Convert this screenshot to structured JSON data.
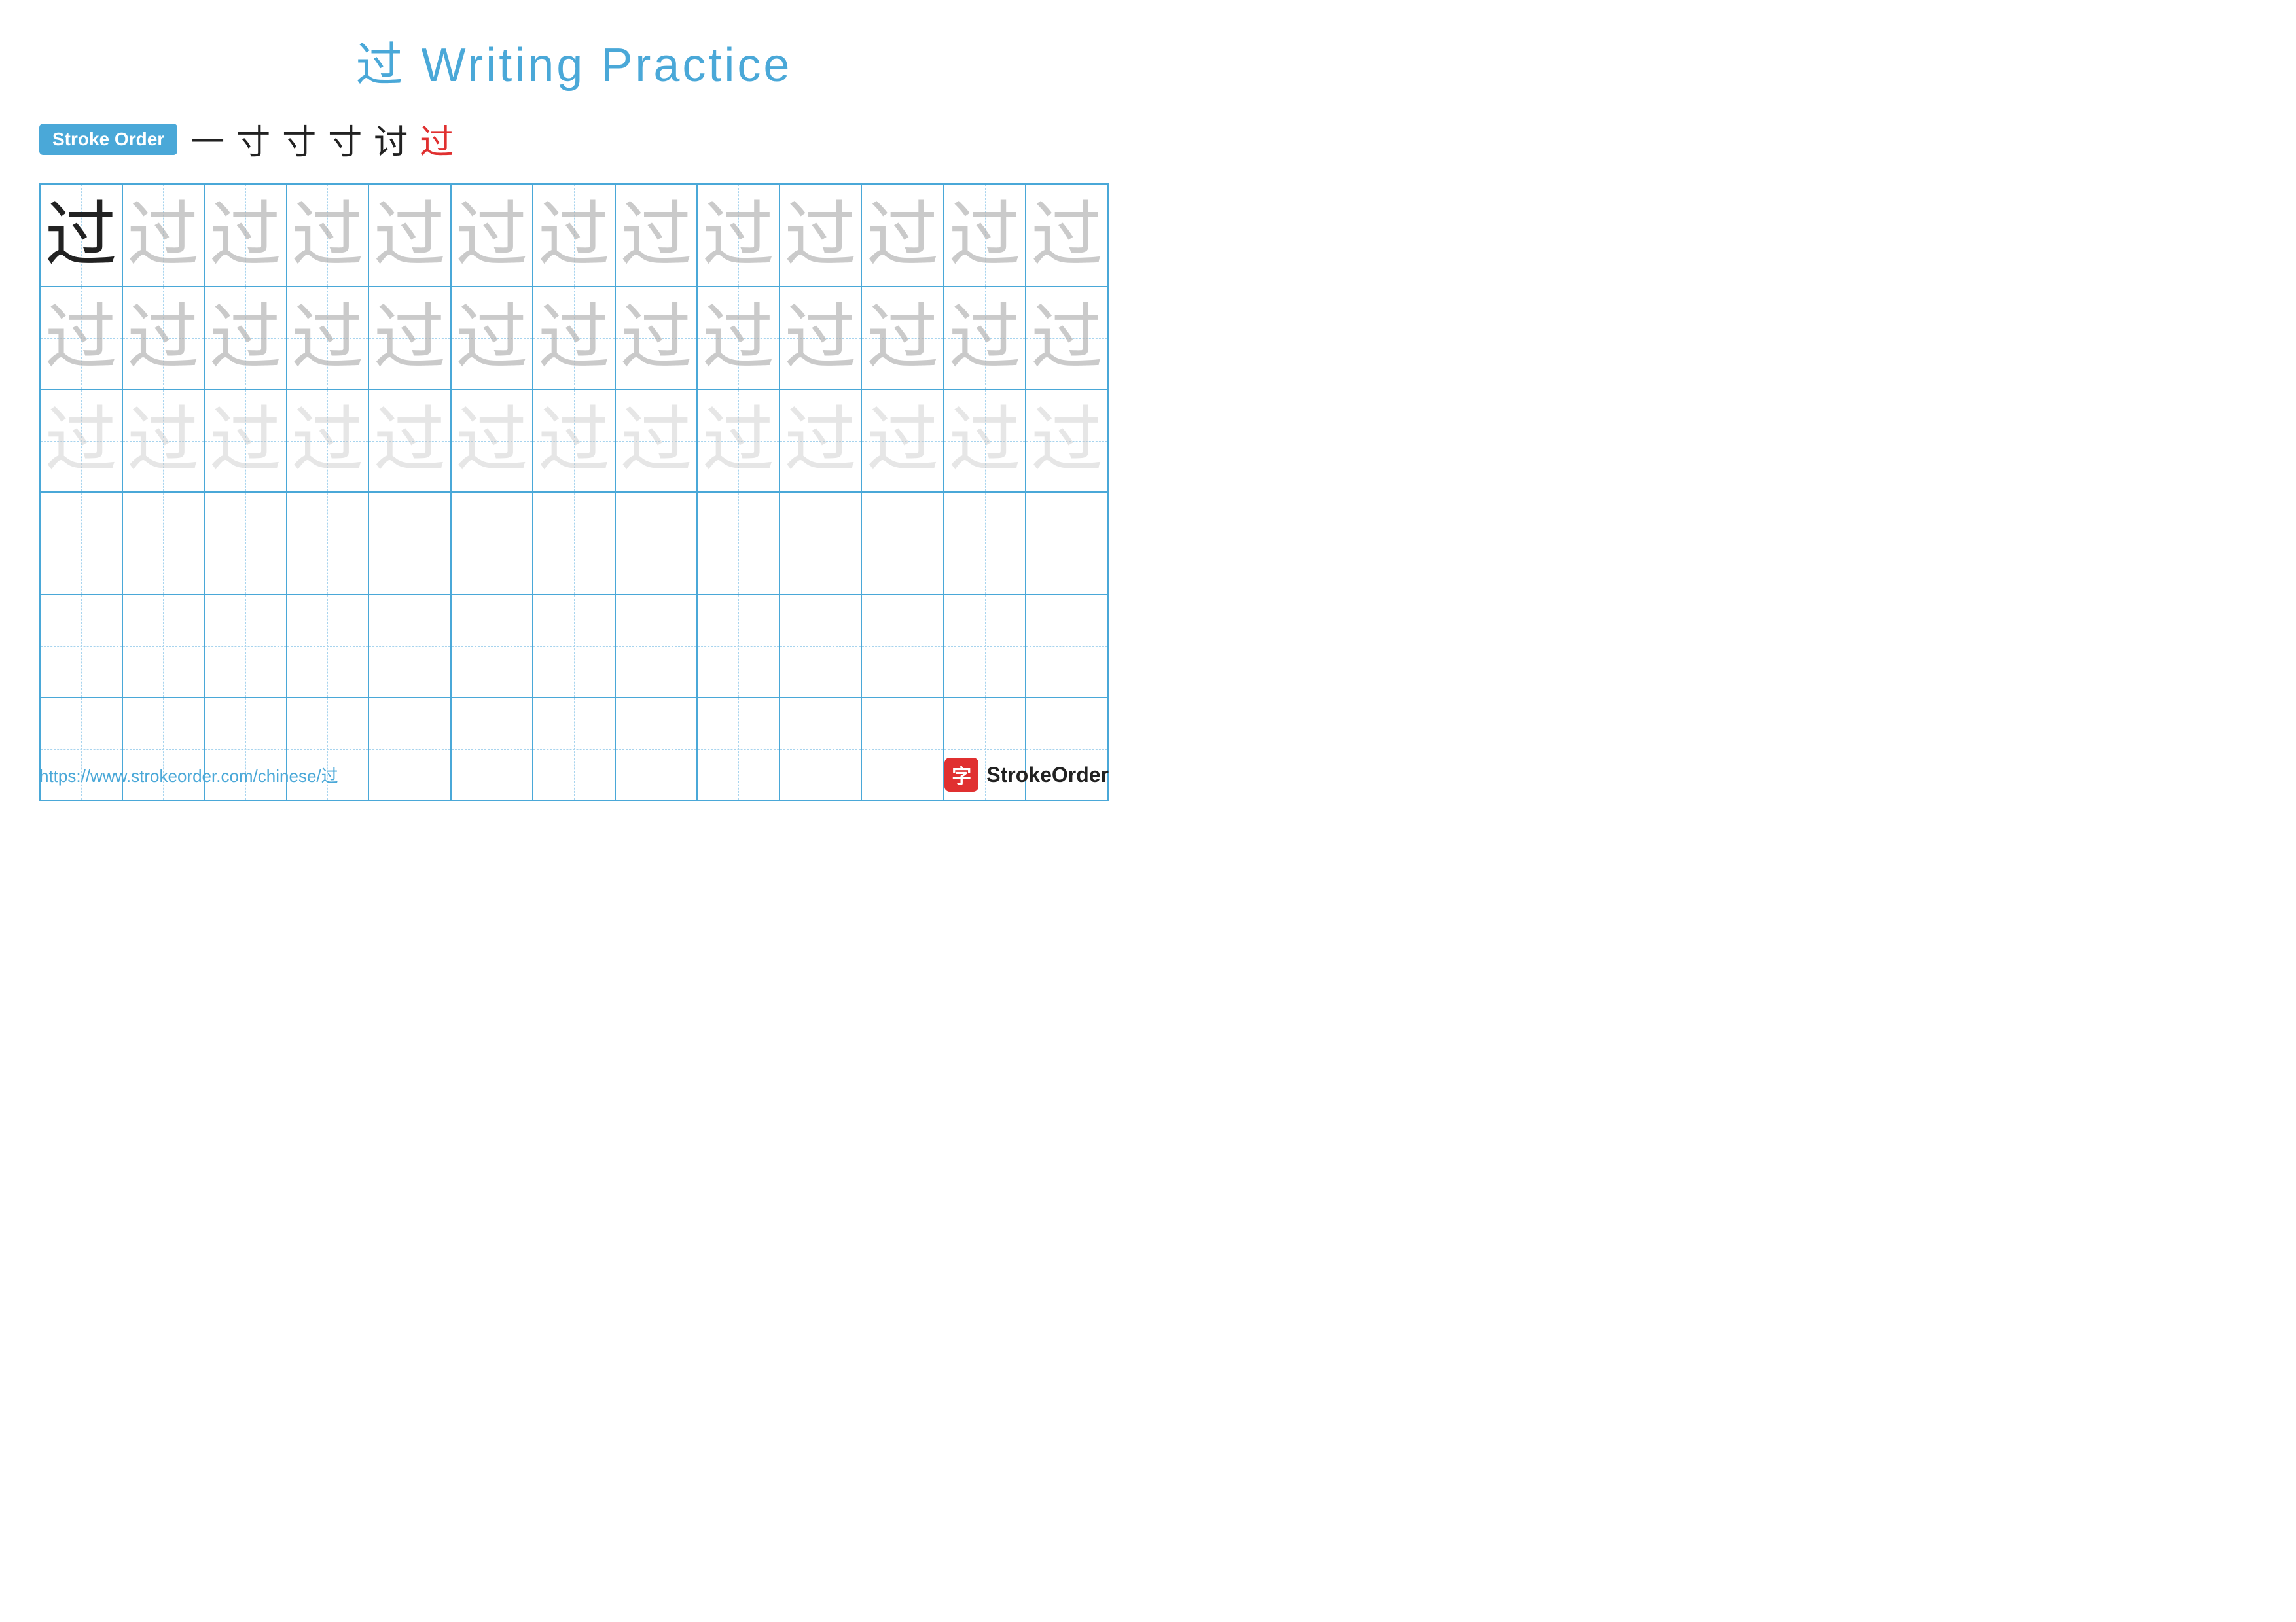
{
  "title": {
    "char": "过",
    "text": " Writing Practice"
  },
  "stroke_order": {
    "badge_label": "Stroke Order",
    "sequence": [
      "一",
      "寸",
      "寸",
      "寸",
      "讨",
      "过"
    ]
  },
  "grid": {
    "rows": 6,
    "cols": 13,
    "row_types": [
      "example",
      "ghost_dark",
      "ghost_lighter",
      "empty",
      "empty",
      "empty"
    ],
    "char": "过"
  },
  "footer": {
    "url": "https://www.strokeorder.com/chinese/过",
    "logo_icon": "字",
    "logo_text": "StrokeOrder"
  }
}
